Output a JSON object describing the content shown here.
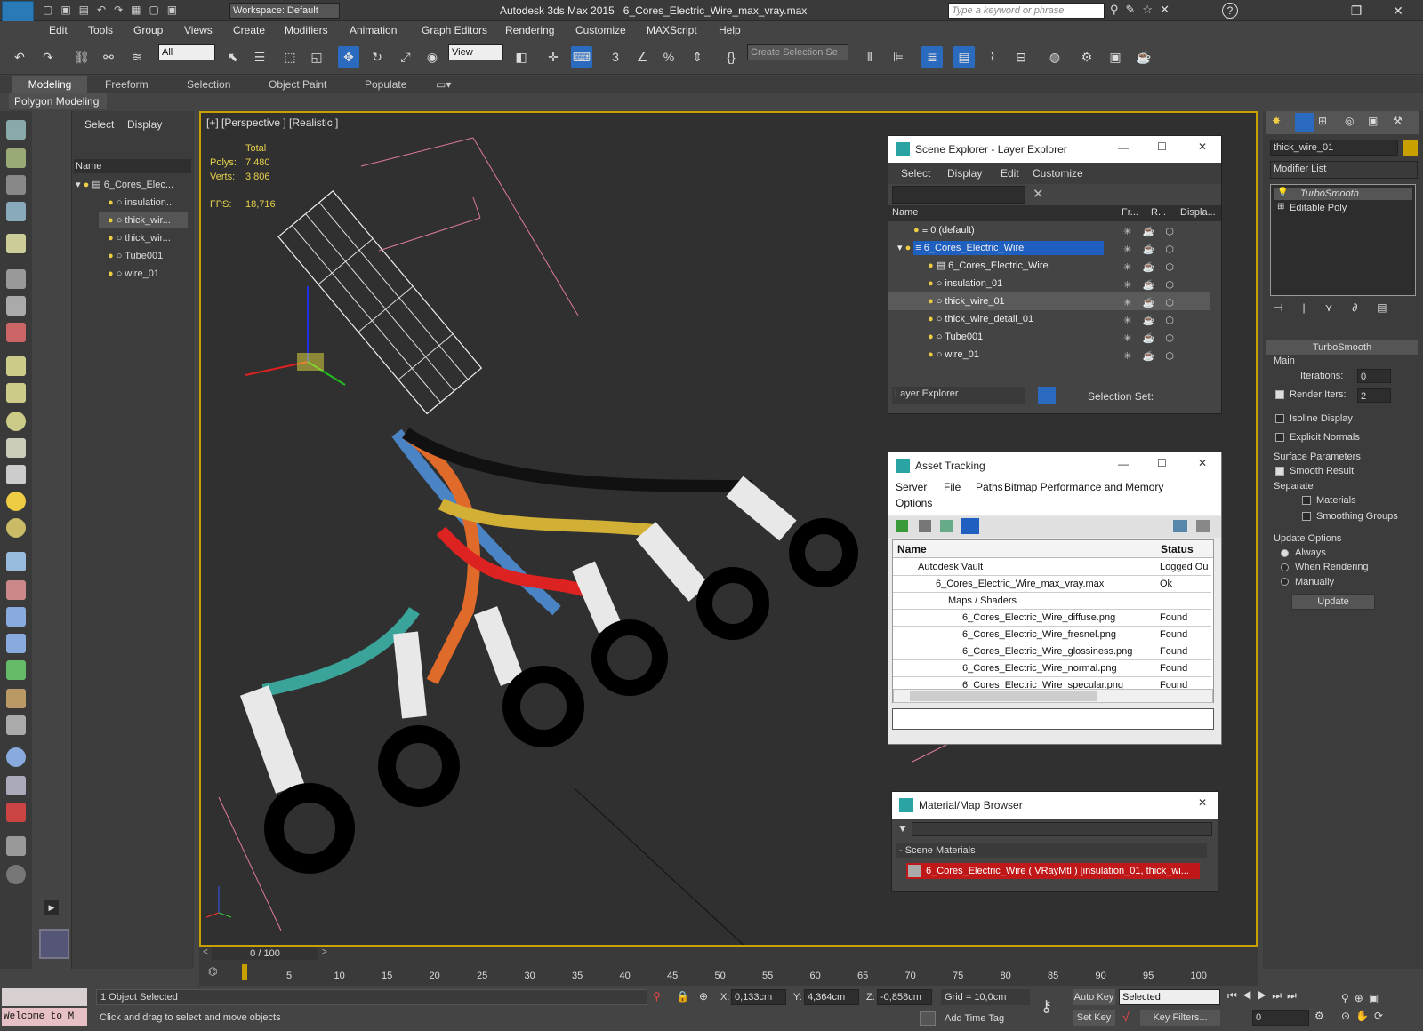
{
  "title": {
    "app": "Autodesk 3ds Max  2015",
    "file": "6_Cores_Electric_Wire_max_vray.max",
    "workspace": "Workspace: Default",
    "search_placeholder": "Type a keyword or phrase"
  },
  "menu": [
    "Edit",
    "Tools",
    "Group",
    "Views",
    "Create",
    "Modifiers",
    "Animation",
    "Graph Editors",
    "Rendering",
    "Customize",
    "MAXScript",
    "Help"
  ],
  "toolbar": {
    "filter": "All",
    "refcoord": "View",
    "selection_set": "Create Selection Se"
  },
  "ribbon": {
    "tabs": [
      "Modeling",
      "Freeform",
      "Selection",
      "Object Paint",
      "Populate"
    ],
    "sub": "Polygon Modeling"
  },
  "scene_explorer": {
    "menu": [
      "Select",
      "Display"
    ],
    "col_name": "Name",
    "rows": [
      "6_Cores_Elec...",
      "insulation...",
      "thick_wir...",
      "thick_wir...",
      "Tube001",
      "wire_01"
    ]
  },
  "viewport": {
    "label": "[+] [Perspective ] [Realistic ]",
    "stats": {
      "total": "Total",
      "polys_label": "Polys:",
      "polys": "7 480",
      "verts_label": "Verts:",
      "verts": "3 806",
      "fps_label": "FPS:",
      "fps": "18,716"
    }
  },
  "layer_explorer": {
    "title": "Scene Explorer - Layer Explorer",
    "menu": [
      "Select",
      "Display",
      "Edit",
      "Customize"
    ],
    "cols": [
      "Name",
      "Fr...",
      "R...",
      "Displa..."
    ],
    "rows": [
      "0 (default)",
      "6_Cores_Electric_Wire",
      "6_Cores_Electric_Wire",
      "insulation_01",
      "thick_wire_01",
      "thick_wire_detail_01",
      "Tube001",
      "wire_01"
    ],
    "footer": "Layer Explorer",
    "selset": "Selection Set:"
  },
  "asset_tracking": {
    "title": "Asset Tracking",
    "menu": [
      "Server",
      "File",
      "Paths",
      "Bitmap Performance and Memory",
      "Options"
    ],
    "cols": [
      "Name",
      "Status"
    ],
    "rows": [
      {
        "name": "Autodesk Vault",
        "status": "Logged Ou"
      },
      {
        "name": "6_Cores_Electric_Wire_max_vray.max",
        "status": "Ok"
      },
      {
        "name": "Maps / Shaders",
        "status": ""
      },
      {
        "name": "6_Cores_Electric_Wire_diffuse.png",
        "status": "Found"
      },
      {
        "name": "6_Cores_Electric_Wire_fresnel.png",
        "status": "Found"
      },
      {
        "name": "6_Cores_Electric_Wire_glossiness.png",
        "status": "Found"
      },
      {
        "name": "6_Cores_Electric_Wire_normal.png",
        "status": "Found"
      },
      {
        "name": "6_Cores_Electric_Wire_specular.png",
        "status": "Found"
      }
    ]
  },
  "material_browser": {
    "title": "Material/Map Browser",
    "section": "- Scene Materials",
    "item": "6_Cores_Electric_Wire  ( VRayMtl )  [insulation_01, thick_wi..."
  },
  "command_panel": {
    "object_name": "thick_wire_01",
    "modifier_list": "Modifier List",
    "stack": [
      "TurboSmooth",
      "Editable Poly"
    ],
    "rollout": "TurboSmooth",
    "main": "Main",
    "iterations_label": "Iterations:",
    "iterations": "0",
    "render_iters_label": "Render Iters:",
    "render_iters": "2",
    "isoline": "Isoline Display",
    "explicit": "Explicit Normals",
    "surface": "Surface Parameters",
    "smooth": "Smooth Result",
    "separate": "Separate",
    "materials": "Materials",
    "smoothing": "Smoothing Groups",
    "update_options": "Update Options",
    "always": "Always",
    "when_rendering": "When Rendering",
    "manually": "Manually",
    "update": "Update"
  },
  "timeline": {
    "frame": "0 / 100",
    "ticks": [
      "5",
      "10",
      "15",
      "20",
      "25",
      "30",
      "35",
      "40",
      "45",
      "50",
      "55",
      "60",
      "65",
      "70",
      "75",
      "80",
      "85",
      "90",
      "95",
      "100"
    ]
  },
  "status": {
    "welcome": "Welcome to M",
    "selected": "1 Object Selected",
    "prompt": "Click and drag to select and move objects",
    "x_label": "X:",
    "x": "0,133cm",
    "y_label": "Y:",
    "y": "4,364cm",
    "z_label": "Z:",
    "z": "-0,858cm",
    "grid": "Grid = 10,0cm",
    "add_time_tag": "Add Time Tag",
    "auto_key": "Auto Key",
    "set_key": "Set Key",
    "key_mode": "Selected",
    "key_filters": "Key Filters...",
    "frame": "0"
  }
}
